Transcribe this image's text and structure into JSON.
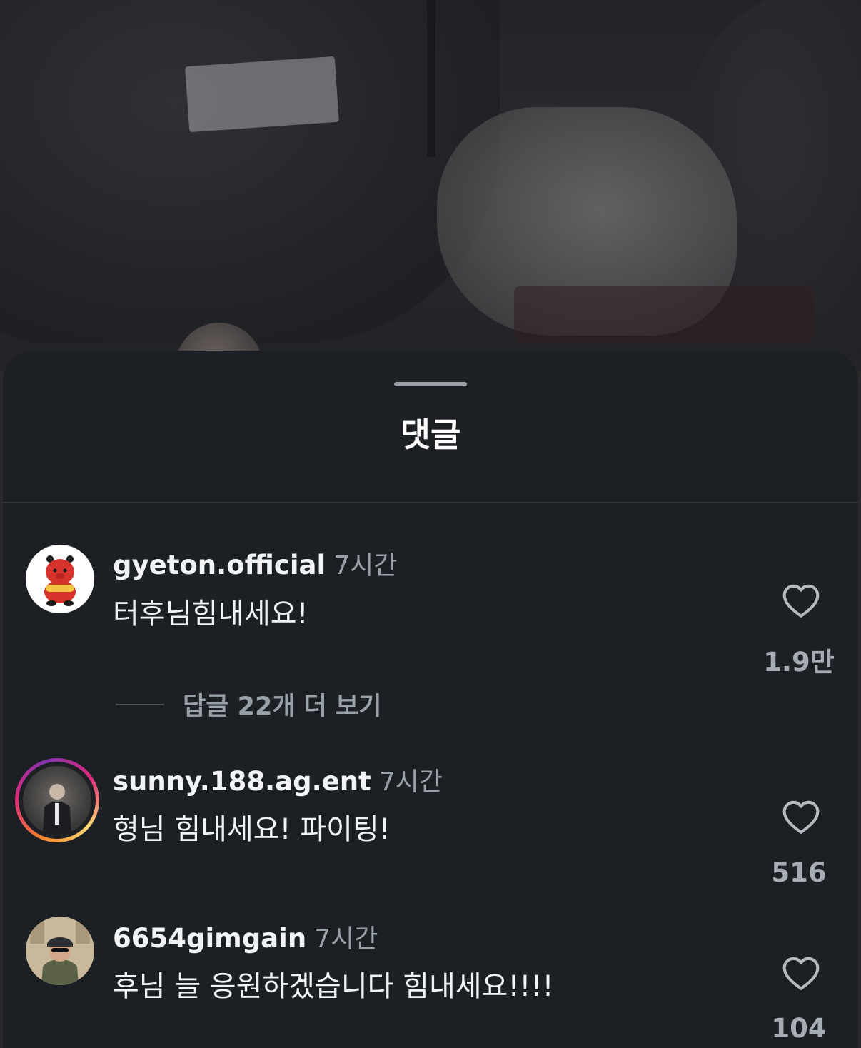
{
  "sheet": {
    "title": "댓글"
  },
  "comments": [
    {
      "username": "gyeton.official",
      "time": "7시간",
      "text": "터후님힘내세요!",
      "likes": "1.9만",
      "avatar_icon": "red-bear-mascot-icon"
    },
    {
      "username": "sunny.188.ag.ent",
      "time": "7시간",
      "text": "형님 힘내세요! 파이팅!",
      "likes": "516",
      "avatar_icon": "person-photo",
      "story_ring": true
    },
    {
      "username": "6654gimgain",
      "time": "7시간",
      "text": "후님 늘 응원하겠습니다 힘내세요!!!!",
      "likes": "104",
      "avatar_icon": "person-photo"
    }
  ],
  "replies": {
    "label": "답글 22개 더 보기"
  },
  "colors": {
    "sheet_bg": "#1c2024",
    "text": "#f2f3f5",
    "muted": "#98a0a8",
    "ring_gradient": [
      "#f58529",
      "#dd2a7b",
      "#8134af"
    ]
  }
}
